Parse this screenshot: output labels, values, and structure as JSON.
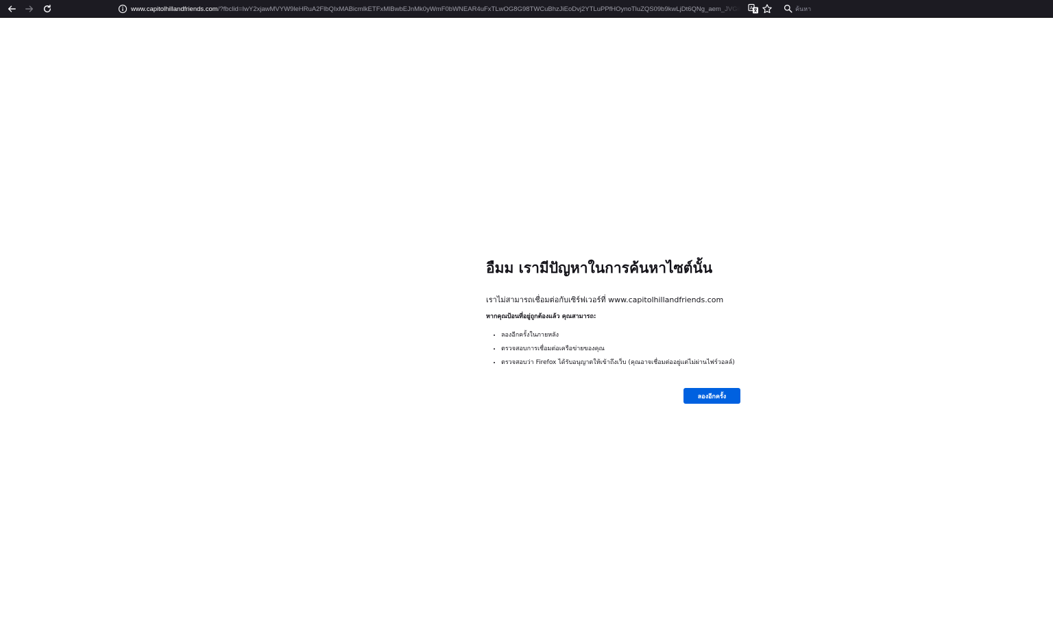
{
  "browser": {
    "url_domain": "www.capitolhillandfriends.com",
    "url_rest": "/?fbclid=IwY2xjawMVYW9leHRuA2FlbQIxMABicmlkETFxMlBwbEJnMk0yWmF0bWNEAR4uFxTLwOG8G98TWCuBhzJiEoDvj2YTLuPPfHOynoTluZQS09b9kwLjDt6QNg_aem_JVGiIulZw",
    "search_placeholder": "ค้นหา",
    "colors": {
      "toolbar_bg": "#1c1b22",
      "icon": "#fbfbfe"
    },
    "icons": [
      "back-arrow-icon",
      "forward-arrow-icon",
      "reload-icon",
      "info-icon",
      "translate-icon",
      "bookmark-star-icon",
      "search-icon"
    ]
  },
  "error": {
    "title": "อืมม เรามีปัญหาในการค้นหาไซต์นั้น",
    "description": "เราไม่สามารถเชื่อมต่อกับเซิร์ฟเวอร์ที่ www.capitolhillandfriends.com",
    "subtitle": "หากคุณป้อนที่อยู่ถูกต้องแล้ว คุณสามารถ:",
    "suggestions": [
      "ลองอีกครั้งในภายหลัง",
      "ตรวจสอบการเชื่อมต่อเครือข่ายของคุณ",
      "ตรวจสอบว่า Firefox ได้รับอนุญาตให้เข้าถึงเว็บ (คุณอาจเชื่อมต่ออยู่แต่ไม่ผ่านไฟร์วอลล์)"
    ],
    "retry_label": "ลองอีกครั้ง",
    "colors": {
      "text": "#15141a",
      "button": "#0061e0"
    }
  }
}
